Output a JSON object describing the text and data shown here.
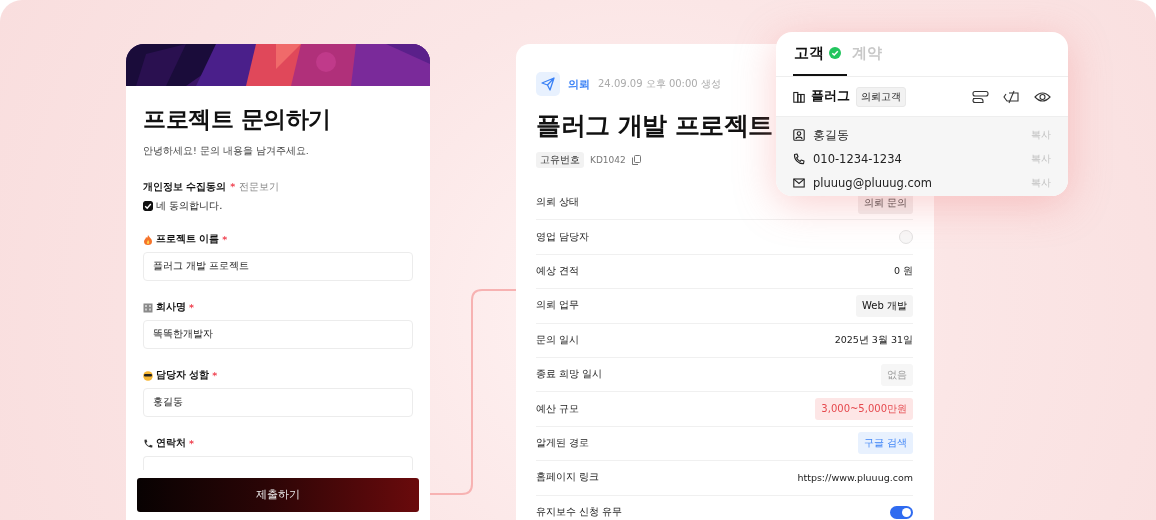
{
  "intake_form": {
    "title": "프로젝트 문의하기",
    "subtitle": "안녕하세요! 문의 내용을 남겨주세요.",
    "consent": {
      "label": "개인정보 수집동의",
      "asterisk": "*",
      "link": "전문보기",
      "checkbox_label": "네 동의합니다.",
      "checked": true
    },
    "fields": [
      {
        "kind": "fire",
        "label": "프로젝트 이름",
        "asterisk": "*",
        "value": "플러그 개발 프로젝트"
      },
      {
        "kind": "building",
        "label": "회사명",
        "asterisk": "*",
        "value": "똑똑한개발자"
      },
      {
        "kind": "sunglasses",
        "label": "담당자 성함",
        "asterisk": "*",
        "value": "홍길동"
      },
      {
        "kind": "phone",
        "label": "연락처",
        "asterisk": "*"
      }
    ],
    "submit_button": "제출하기"
  },
  "request": {
    "badge": "의뢰",
    "created": "24.09.09 오후 00:00 생성",
    "title": "플러그 개발 프로젝트",
    "id_label": "고유번호",
    "id": "KD1042",
    "rows": [
      {
        "label": "의뢰 상태",
        "kind": "tag",
        "value": "의뢰 문의",
        "color": "#f1eded"
      },
      {
        "label": "영업 담당자",
        "kind": "avatar"
      },
      {
        "label": "예상 견적",
        "kind": "text",
        "value": "0 원"
      },
      {
        "label": "의뢰 업무",
        "kind": "tag",
        "value": "Web 개발",
        "color": "#f4f4f4"
      },
      {
        "label": "문의 일시",
        "kind": "text",
        "value": "2025년 3월 31일"
      },
      {
        "label": "종료 희망 일시",
        "kind": "tag",
        "value": "없음",
        "color": "#f6f6f6"
      },
      {
        "label": "예산 규모",
        "kind": "tag",
        "value": "3,000~5,000만원",
        "color": "#fde6e6"
      },
      {
        "label": "알게된 경로",
        "kind": "tag",
        "value": "구글 검색",
        "color": "#e8f1fe"
      },
      {
        "label": "홈페이지 링크",
        "kind": "text",
        "value": "https://www.pluuug.com"
      },
      {
        "label": "유지보수 신청 유무",
        "kind": "toggle",
        "on": true
      }
    ]
  },
  "customer_popup": {
    "tabs": [
      {
        "label": "고객",
        "selected": true,
        "verified": true
      },
      {
        "label": "계약",
        "selected": false,
        "verified": false
      }
    ],
    "company": {
      "name": "플러그",
      "tag": "의뢰고객"
    },
    "contacts": [
      {
        "kind": "person",
        "value": "홍길동",
        "action": "복사"
      },
      {
        "kind": "phone",
        "value": "010-1234-1234",
        "action": "복사"
      },
      {
        "kind": "mail",
        "value": "pluuug@pluuug.com",
        "action": "복사"
      }
    ]
  }
}
